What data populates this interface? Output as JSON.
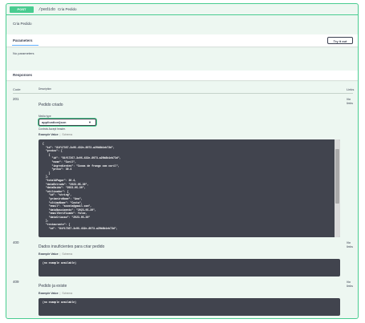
{
  "summary": {
    "method": "POST",
    "path": "/pedido",
    "description": "Cria Pedido"
  },
  "operation_description": "Cria Pedido",
  "parameters": {
    "title": "Parameters",
    "try_button": "Try it out",
    "empty": "No parameters"
  },
  "responses": {
    "title": "Responses",
    "columns": {
      "code": "Code",
      "description": "Description",
      "links": "Links"
    },
    "media_type_label": "Media type",
    "selected_media_type": "application/json",
    "accept_note": "Controls Accept header.",
    "tab_example": "Example Value",
    "tab_separator": "|",
    "tab_schema": "Schema",
    "items": [
      {
        "code": "201",
        "description": "Pedido criado",
        "links": "No links"
      },
      {
        "code": "400",
        "description": "Dados insuficientes para criar pedido",
        "links": "No links",
        "example": "(no example available)"
      },
      {
        "code": "409",
        "description": "Pedido ja existe",
        "links": "No links",
        "example": "(no example available)"
      }
    ],
    "example_json": "{\n  \"id\": \"81f17367-3c06-432e-8073-a20b8b1eb73d\",\n  \"pratos\": [\n    {\n      \"id\": \"81f17367-3c06-432e-8073-a20b8b1eb73d\",\n      \"nome\": \"Curil\",\n      \"ingredientes\": \"Coxas de frango com curil\",\n      \"preco\": 30.4\n    }\n  ],\n  \"totalAPagar\": 30.4,\n  \"dataEntrada\": \"2023-05-30\",\n  \"dataSaida\": \"2023-05-30\",\n  \"utilizador\": {\n    \"id\": \"string\",\n    \"primeiroNome\": \"Ana\",\n    \"ultimoNome\": \"Costa\",\n    \"email\": \"acosta@gmail.com\",\n    \"dataNascimento\": \"2023-05-30\",\n    \"emailVerificado\": false,\n    \"dataCriacao\": \"2023-05-30\"\n  },\n  \"restaurante\": {\n    \"id\": \"81f17367-3c06-432e-8073-a20b8b1eb73d\","
  }
}
